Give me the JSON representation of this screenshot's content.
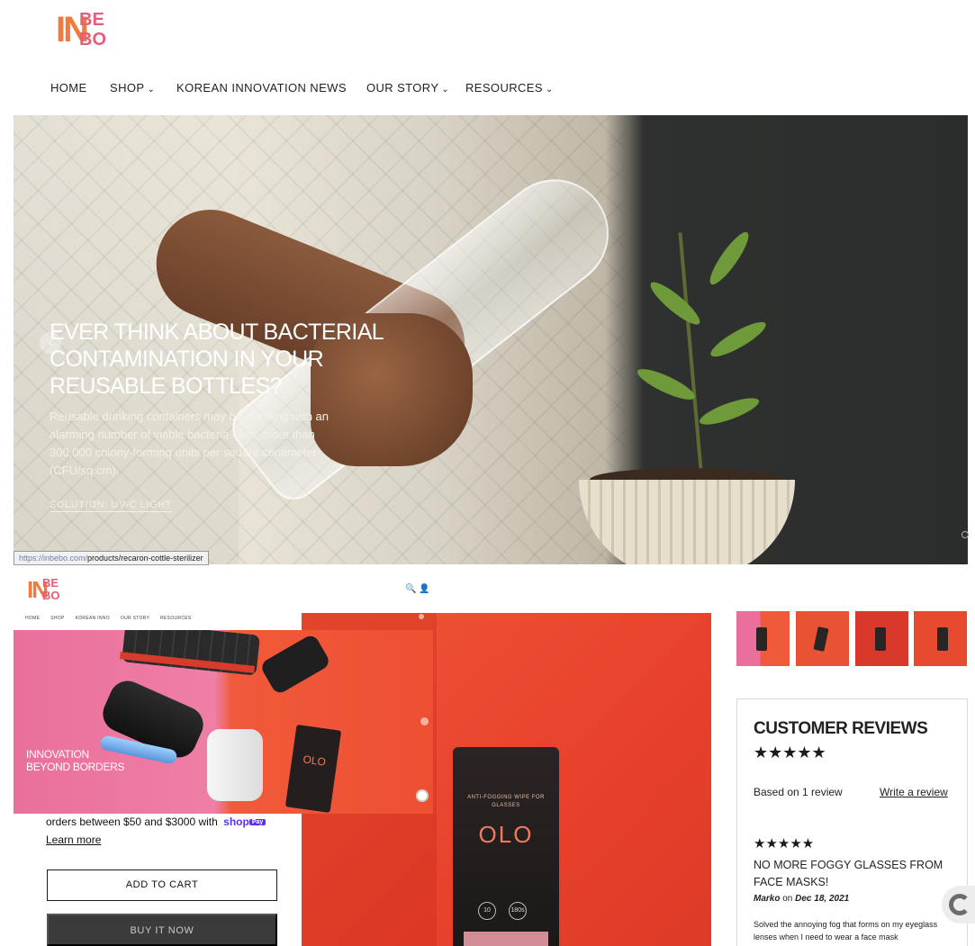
{
  "brand": {
    "logo_in": "IN",
    "logo_be": "BE",
    "logo_bo": "BO"
  },
  "nav": {
    "items": [
      {
        "label": "HOME",
        "dropdown": false
      },
      {
        "label": "SHOP",
        "dropdown": true
      },
      {
        "label": "KOREAN INNOVATION NEWS",
        "dropdown": false
      },
      {
        "label": "OUR STORY",
        "dropdown": true
      },
      {
        "label": "RESOURCES",
        "dropdown": true
      }
    ],
    "chevron": "⌄"
  },
  "hero": {
    "title": "EVER THINK ABOUT BACTERIAL CONTAMINATION IN YOUR REUSABLE BOTTLES?",
    "body": "Reusable drinking containers may be crawling with an alarming number of viable bacteria cells: more than 300,000 colony-forming units per square centimeter (CFU/sq cm).",
    "cta": "SOLUTION: UV-C LIGHT",
    "prev_icon": "‹"
  },
  "status_bar": {
    "url_prefix": "https://inbebo.com/",
    "url_rest": "products/recaron-cottle-sterilizer"
  },
  "mini_header": {
    "icons": "🔍 👤",
    "nav": [
      "HOME",
      "SHOP",
      "KOREAN INNO",
      "OUR STORY",
      "RESOURCES"
    ]
  },
  "slide2": {
    "title_line1": "INNOVATION",
    "title_line2": "BEYOND BORDERS",
    "sub": "",
    "sub2": ""
  },
  "product_box": {
    "tagline": "ANTI-FOGGING WIPE FOR GLASSES",
    "brand": "OLO",
    "badge1": "10",
    "badge2": "180s"
  },
  "purchase": {
    "pay_text": "orders between $50 and $3000 with",
    "shop_label": "shop",
    "pay_label": "Pay",
    "learn_more": "Learn more",
    "add_to_cart": "ADD TO CART",
    "buy_now": "BUY IT NOW"
  },
  "reviews": {
    "title": "CUSTOMER REVIEWS",
    "stars": "★★★★★",
    "based_on": "Based on 1 review",
    "write_review": "Write a review",
    "review": {
      "stars": "★★★★★",
      "headline": "NO MORE FOGGY GLASSES FROM FACE MASKS!",
      "author": "Marko",
      "on": "on",
      "date": "Dec 18, 2021",
      "body": "Solved the annoying fog that forms on my eyeglass lenses when I need to wear a face mask"
    }
  },
  "colors": {
    "logo_orange": "#f07b3c",
    "logo_pink": "#e35d7c",
    "accent_red": "#e8412c",
    "shop_pay": "#5a31f4"
  }
}
